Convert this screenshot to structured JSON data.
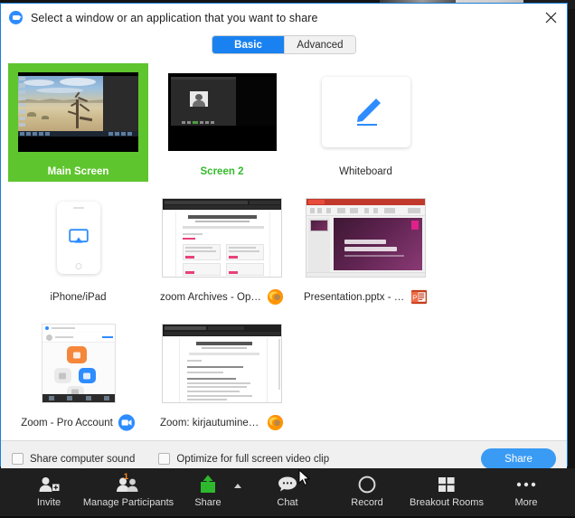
{
  "dialog": {
    "title": "Select a window or an application that you want to share",
    "logo_icon": "zoom-logo-icon",
    "close_icon": "close-icon",
    "tabs": [
      {
        "label": "Basic",
        "active": true
      },
      {
        "label": "Advanced",
        "active": false
      }
    ]
  },
  "sources": [
    {
      "label": "Main Screen",
      "selected": true,
      "kind": "screen",
      "app_icon": null
    },
    {
      "label": "Screen 2",
      "selected": false,
      "kind": "screen2",
      "app_icon": null
    },
    {
      "label": "Whiteboard",
      "selected": false,
      "kind": "whiteboard",
      "app_icon": "pencil-icon"
    },
    {
      "label": "iPhone/iPad",
      "selected": false,
      "kind": "phone",
      "app_icon": "airplay-icon"
    },
    {
      "label": "zoom Archives - Opettaj...",
      "selected": false,
      "kind": "firefox-window",
      "app_icon": "firefox-icon"
    },
    {
      "label": "Presentation.pptx - Pow...",
      "selected": false,
      "kind": "powerpoint-window",
      "app_icon": "powerpoint-icon"
    },
    {
      "label": "Zoom - Pro Account",
      "selected": false,
      "kind": "zoom-app-window",
      "app_icon": "zoom-icon"
    },
    {
      "label": "Zoom: kirjautuminen ist...",
      "selected": false,
      "kind": "firefox-page-window",
      "app_icon": "firefox-icon"
    }
  ],
  "footer": {
    "share_computer_sound": {
      "label": "Share computer sound",
      "checked": false
    },
    "optimize_video_clip": {
      "label": "Optimize for full screen video clip",
      "checked": false
    },
    "share_button": "Share"
  },
  "toolbar": {
    "items": [
      {
        "label": "Invite",
        "icon": "invite-icon",
        "badge": null,
        "caret": false
      },
      {
        "label": "Manage Participants",
        "icon": "participants-icon",
        "badge": "1",
        "caret": false
      },
      {
        "label": "Share",
        "icon": "share-screen-icon",
        "badge": null,
        "caret": true
      },
      {
        "label": "Chat",
        "icon": "chat-icon",
        "badge": null,
        "caret": false
      },
      {
        "label": "Record",
        "icon": "record-icon",
        "badge": null,
        "caret": false
      },
      {
        "label": "Breakout Rooms",
        "icon": "breakout-rooms-icon",
        "badge": null,
        "caret": false
      },
      {
        "label": "More",
        "icon": "more-icon",
        "badge": null,
        "caret": false
      }
    ]
  },
  "colors": {
    "accent_blue": "#1a82f0",
    "selected_green": "#5fc52e",
    "screen2_green": "#35bb2c",
    "share_button_blue": "#3a9bf4",
    "badge_orange": "#ff8c1a",
    "toolbar_bg": "#1f1f1f"
  }
}
